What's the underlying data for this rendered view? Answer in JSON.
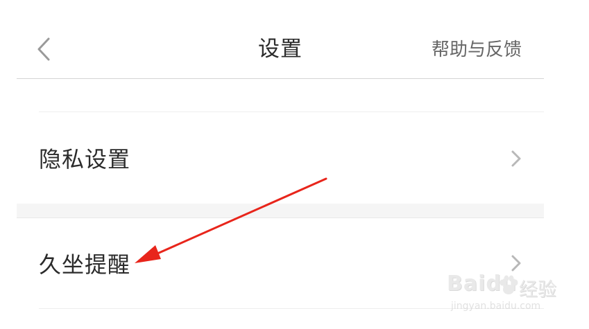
{
  "header": {
    "back_icon": "chevron-left-icon",
    "title": "设置",
    "help_label": "帮助与反馈"
  },
  "settings": {
    "items": [
      {
        "label": "隐私设置",
        "icon": "chevron-right-icon"
      },
      {
        "label": "久坐提醒",
        "icon": "chevron-right-icon"
      }
    ]
  },
  "annotation": {
    "type": "red-arrow",
    "color": "#e8251b",
    "points_to": "久坐提醒"
  },
  "watermark": {
    "logo": "Bai",
    "logo_suffix": "du",
    "brand": "经验",
    "url": "jingyan.baidu.com"
  },
  "colors": {
    "text": "#2b2b2b",
    "secondary_text": "#666666",
    "chevron": "#b8b8b8",
    "divider": "#d4d4d4",
    "section_gap": "#f5f5f5"
  }
}
